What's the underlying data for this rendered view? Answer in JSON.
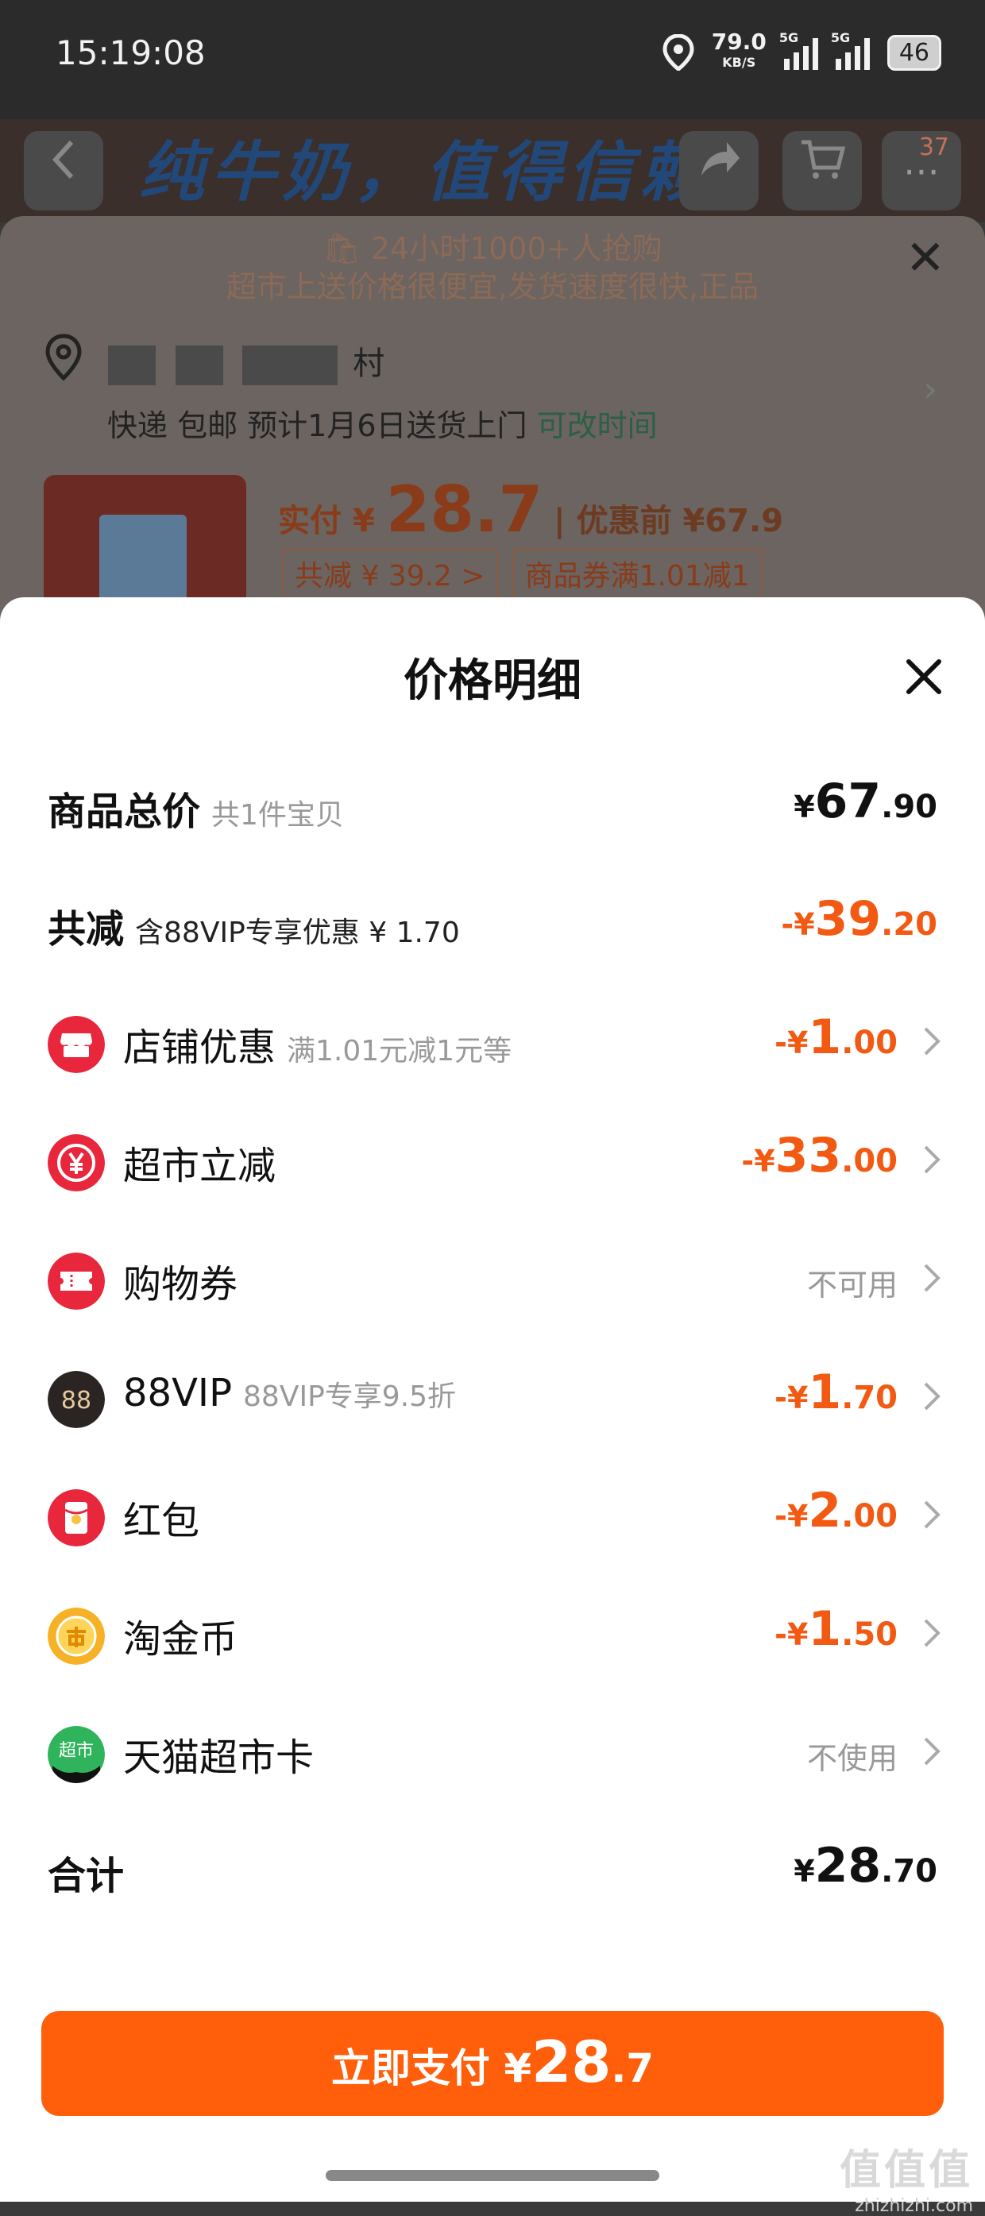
{
  "status_bar": {
    "time": "15:19:08",
    "speed": "79.0",
    "speed_unit": "KB/S",
    "network1": "5G",
    "network2": "5G",
    "battery": "46"
  },
  "background": {
    "slogan": "纯牛奶，值得信赖",
    "cart_count": "37",
    "promo1": "24小时1000+人抢购",
    "promo2": "超市上送价格很便宜,发货速度很快,正品",
    "address_tail": "村",
    "shipping": "快递 包邮 预计1月6日送货上门",
    "change_time": "可改时间",
    "paid_label": "实付",
    "paid_currency": "¥",
    "paid_value": "28.7",
    "before_label": "优惠前",
    "before_value": "¥67.9",
    "tag_total_discount": "共减 ¥ 39.2 >",
    "tag_coupon": "商品券满1.01减1"
  },
  "sheet": {
    "title": "价格明细",
    "rows": [
      {
        "label": "商品总价",
        "sub": "共1件宝贝",
        "currency": "¥",
        "int": "67",
        "dec": ".90"
      },
      {
        "label": "共减",
        "sub": "含88VIP专享优惠 ¥ 1.70",
        "currency": "-¥",
        "int": "39",
        "dec": ".20"
      },
      {
        "label": "店铺优惠",
        "sub": "满1.01元减1元等",
        "currency": "-¥",
        "int": "1",
        "dec": ".00",
        "icon": "store-icon"
      },
      {
        "label": "超市立减",
        "sub": "",
        "currency": "-¥",
        "int": "33",
        "dec": ".00",
        "icon": "yuan-discount-icon"
      },
      {
        "label": "购物券",
        "sub": "",
        "status": "不可用",
        "icon": "ticket-icon"
      },
      {
        "label": "88VIP",
        "sub": "88VIP专享9.5折",
        "currency": "-¥",
        "int": "1",
        "dec": ".70",
        "icon": "vip88-icon"
      },
      {
        "label": "红包",
        "sub": "",
        "currency": "-¥",
        "int": "2",
        "dec": ".00",
        "icon": "red-envelope-icon"
      },
      {
        "label": "淘金币",
        "sub": "",
        "currency": "-¥",
        "int": "1",
        "dec": ".50",
        "icon": "gold-coin-icon"
      },
      {
        "label": "天猫超市卡",
        "sub": "",
        "status": "不使用",
        "icon": "tmall-supermarket-card-icon"
      },
      {
        "label": "合计",
        "currency": "¥",
        "int": "28",
        "dec": ".70"
      }
    ],
    "icon_texts": {
      "vip88": "88",
      "supermarket": "超市"
    }
  },
  "pay_button": {
    "label": "立即支付",
    "currency": "¥",
    "int": "28",
    "dec": ".7"
  },
  "watermark": {
    "main": "值值值",
    "sub": "zhizhizhi.com"
  },
  "colors": {
    "accent": "#ff5e0a",
    "discount": "#f25a13",
    "icon_red": "#e8263c"
  }
}
